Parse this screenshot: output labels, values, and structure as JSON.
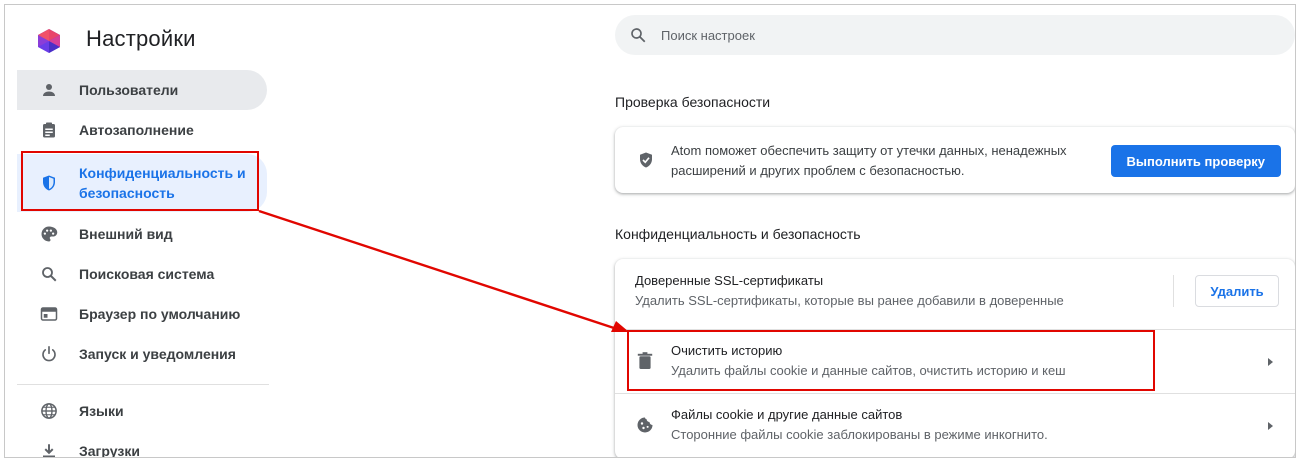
{
  "app": {
    "title": "Настройки"
  },
  "search": {
    "placeholder": "Поиск настроек"
  },
  "sidebar": {
    "items": [
      {
        "label": "Пользователи",
        "icon": "person-icon"
      },
      {
        "label": "Автозаполнение",
        "icon": "clipboard-icon"
      },
      {
        "label": "Конфиденциальность и безопасность",
        "icon": "shield-icon",
        "active": true
      },
      {
        "label": "Внешний вид",
        "icon": "palette-icon"
      },
      {
        "label": "Поисковая система",
        "icon": "search-icon"
      },
      {
        "label": "Браузер по умолчанию",
        "icon": "browser-icon"
      },
      {
        "label": "Запуск и уведомления",
        "icon": "power-icon"
      },
      {
        "label": "Языки",
        "icon": "globe-icon"
      },
      {
        "label": "Загрузки",
        "icon": "download-icon"
      }
    ]
  },
  "safety_check": {
    "section_title": "Проверка безопасности",
    "text": "Atom поможет обеспечить защиту от утечки данных, ненадежных расширений и других проблем с безопасностью.",
    "button_label": "Выполнить проверку"
  },
  "privacy": {
    "section_title": "Конфиденциальность и безопасность",
    "rows": [
      {
        "title": "Доверенные SSL-сертификаты",
        "subtitle": "Удалить SSL-сертификаты, которые вы ранее добавили в доверенные",
        "button_label": "Удалить"
      },
      {
        "title": "Очистить историю",
        "subtitle": "Удалить файлы cookie и данные сайтов, очистить историю и кеш",
        "icon": "trash-icon"
      },
      {
        "title": "Файлы cookie и другие данные сайтов",
        "subtitle": "Сторонние файлы cookie заблокированы в режиме инкогнито.",
        "icon": "cookie-icon"
      }
    ]
  },
  "colors": {
    "accent": "#1a73e8",
    "annotation": "#e10600",
    "active_bg": "#e8f0fe"
  }
}
